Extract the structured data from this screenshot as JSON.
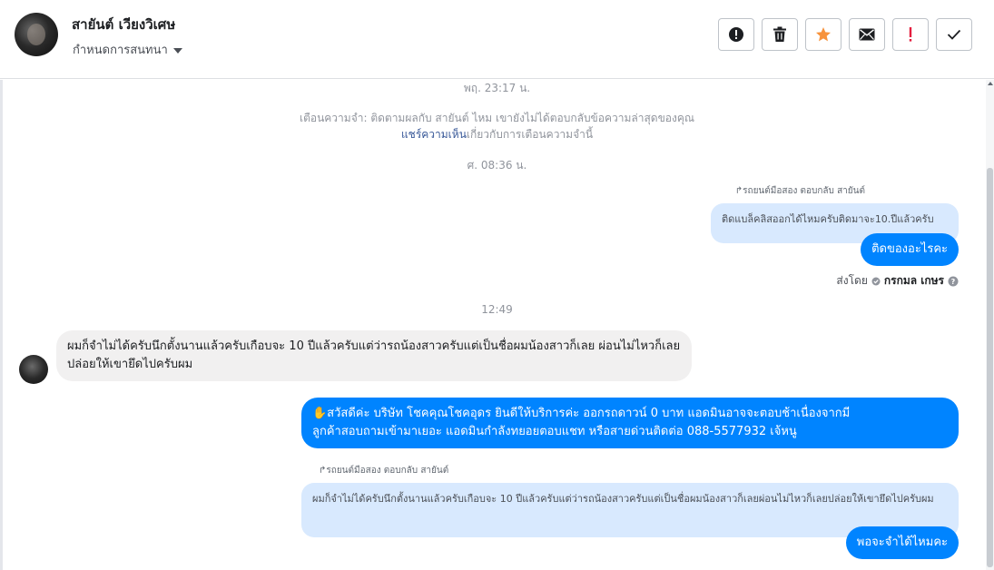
{
  "header": {
    "contact_name": "สายันต์ เวียงวิเศษ",
    "settings_label": "กำหนดการสนทนา"
  },
  "actions": [
    {
      "name": "report-button",
      "icon": "exclamation-circle-icon"
    },
    {
      "name": "delete-button",
      "icon": "trash-icon"
    },
    {
      "name": "star-button",
      "icon": "star-icon"
    },
    {
      "name": "mark-unread-button",
      "icon": "envelope-icon"
    },
    {
      "name": "important-button",
      "icon": "exclamation-icon"
    },
    {
      "name": "mark-done-button",
      "icon": "check-icon"
    }
  ],
  "colors": {
    "accent_blue": "#0084ff",
    "quote_bg": "#d8e9fe",
    "star_orange": "#f7923b",
    "alert_red": "#e41e3f"
  },
  "messages": {
    "ts1": "พฤ. 23:17 น.",
    "reminder_text": "เตือนความจำ: ติดตามผลกับ สายันต์ ไหม เขายังไม่ได้ตอบกลับข้อความล่าสุดของคุณ",
    "reminder_link": "แชร์ความเห็น",
    "reminder_suffix": "เกี่ยวกับการเตือนความจำนี้",
    "ts2": "ศ. 08:36 น.",
    "reply_label_1": "รถยนต์มือสอง ตอบกลับ สายันต์",
    "quoted_1": "ติดแบล็คลิสออกได้ไหมครับติดมาจะ10.ปีแล้วครับ",
    "bubble_1": "ติดของอะไรคะ",
    "sent_by_prefix": "ส่งโดย",
    "sent_by_name": "กรกมล เกษร",
    "ts3": "12:49",
    "incoming_1": "ผมก็จำไม่ได้ครับนึกตั้งนานแล้วครับเกือบจะ 10 ปีแล้วครับแต่ว่ารถน้องสาวครับแต่เป็นชื่อผมน้องสาวก็เลย ผ่อนไม่ไหวก็เลยปล่อยให้เขายึดไปครับผม",
    "bubble_2_line1": "✋สวัสดีค่ะ บริษัท โชคคุณโชคอุดร ยินดีให้บริการค่ะ ออกรถดาวน์ 0 บาท แอดมินอาจจะตอบช้าเนื่องจากมี",
    "bubble_2_line2": "ลูกค้าสอบถามเข้ามาเยอะ แอดมินกำลังทยอยตอบแชท หรือสายด่วนติดต่อ 088-5577932 เจ้หนู",
    "reply_label_2": "รถยนต์มือสอง ตอบกลับ สายันต์",
    "quoted_2": "ผมก็จำไม่ได้ครับนึกตั้งนานแล้วครับเกือบจะ 10 ปีแล้วครับแต่ว่ารถน้องสาวครับแต่เป็นชื่อผมน้องสาวก็เลยผ่อนไม่ไหวก็เลยปล่อยให้เขายึดไปครับผม",
    "bubble_3": "พอจะจำได้ไหมคะ"
  }
}
